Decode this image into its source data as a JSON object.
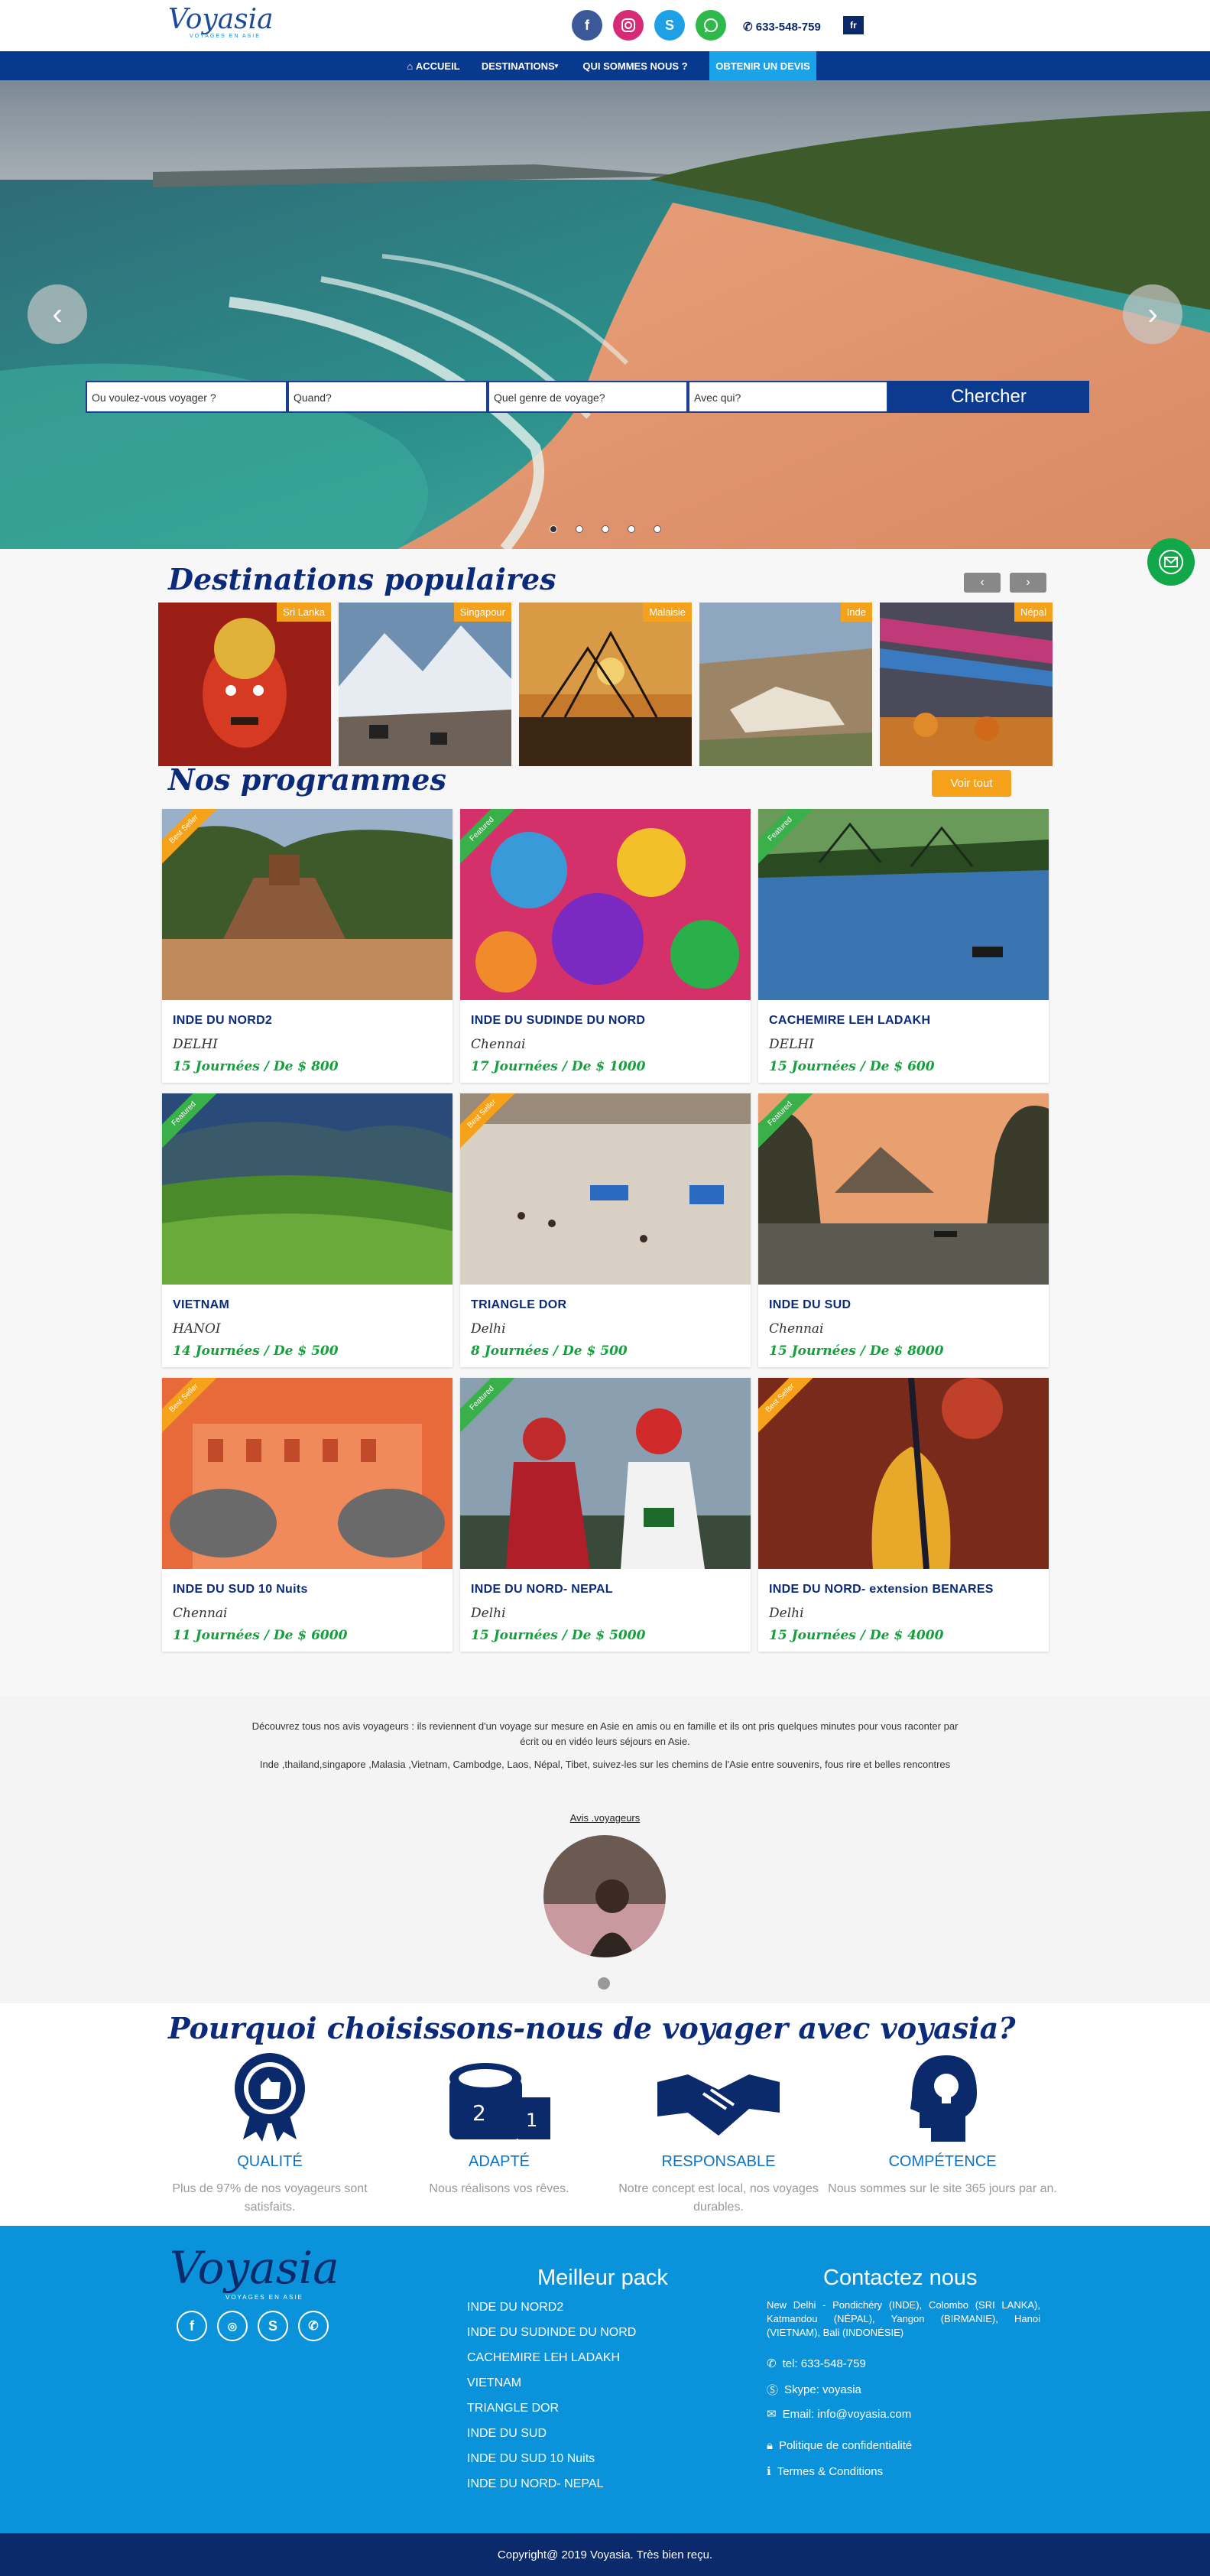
{
  "header": {
    "logo": "Voyasia",
    "logo_sub": "VOYAGES EN ASIE",
    "phone": "633-548-759",
    "lang": "fr",
    "social": [
      "facebook-icon",
      "instagram-icon",
      "skype-icon",
      "whatsapp-icon"
    ]
  },
  "nav": {
    "items": [
      "ACCUEIL",
      "DESTINATIONS",
      "QUI SOMMES NOUS ?",
      "OBTENIR UN DEVIS"
    ]
  },
  "search": {
    "where": "Ou voulez-vous voyager ?",
    "when": "Quand?",
    "kind": "Quel genre de voyage?",
    "with": "Avec qui?",
    "button": "Chercher"
  },
  "destinations": {
    "title": "Destinations populaires",
    "items": [
      "Sri Lanka",
      "Singapour",
      "Malaisie",
      "Inde",
      "Népal"
    ]
  },
  "programs": {
    "title": "Nos programmes",
    "see_all": "Voir tout",
    "cards": [
      {
        "ribbon": "Best Seller",
        "title": "INDE DU NORD2",
        "city": "DELHI",
        "price": "15 Journées / De $ 800"
      },
      {
        "ribbon": "Featured",
        "title": "INDE DU SUDINDE DU NORD",
        "city": "Chennai",
        "price": "17 Journées / De $ 1000"
      },
      {
        "ribbon": "Featured",
        "title": "CACHEMIRE LEH LADAKH",
        "city": "DELHI",
        "price": "15 Journées / De $ 600"
      },
      {
        "ribbon": "Featured",
        "title": "VIETNAM",
        "city": "HANOI",
        "price": "14 Journées / De $ 500"
      },
      {
        "ribbon": "Best Seller",
        "title": "TRIANGLE DOR",
        "city": "Delhi",
        "price": "8 Journées / De $ 500"
      },
      {
        "ribbon": "Featured",
        "title": "INDE DU SUD",
        "city": "Chennai",
        "price": "15 Journées / De $ 8000"
      },
      {
        "ribbon": "Best Seller",
        "title": "INDE DU SUD 10 Nuits",
        "city": "Chennai",
        "price": "11 Journées / De $ 6000"
      },
      {
        "ribbon": "Featured",
        "title": "INDE DU NORD- NEPAL",
        "city": "Delhi",
        "price": "15 Journées / De $ 5000"
      },
      {
        "ribbon": "Best Seller",
        "title": "INDE DU NORD- extension BENARES",
        "city": "Delhi",
        "price": "15 Journées / De $ 4000"
      }
    ]
  },
  "reviews": {
    "p1": "Découvrez tous nos avis voyageurs : ils reviennent d'un voyage sur mesure en Asie en amis ou en famille et ils ont pris quelques minutes pour vous raconter par écrit ou en vidéo leurs séjours en Asie.",
    "p2": "Inde ,thailand,singapore ,Malasia ,Vietnam, Cambodge, Laos, Népal, Tibet, suivez-les sur les chemins de l'Asie entre souvenirs, fous rire et belles rencontres",
    "link": "Avis .voyageurs"
  },
  "why": {
    "title": "Pourquoi choisissons-nous de voyager avec voyasia?",
    "items": [
      {
        "icon": "quality-badge-icon",
        "title": "QUALITÉ",
        "desc": "Plus de 97% de nos voyageurs sont satisfaits."
      },
      {
        "icon": "measuring-tape-icon",
        "title": "ADAPTÉ",
        "desc": "Nous réalisons vos rêves."
      },
      {
        "icon": "handshake-icon",
        "title": "RESPONSABLE",
        "desc": "Notre concept est local, nos voyages durables."
      },
      {
        "icon": "head-lightbulb-icon",
        "title": "COMPÉTENCE",
        "desc": "Nous sommes sur le site 365 jours par an."
      }
    ]
  },
  "footer": {
    "logo": "Voyasia",
    "logo_sub": "VOYAGES EN ASIE",
    "pack_title": "Meilleur pack",
    "pack": [
      "INDE DU NORD2",
      "INDE DU SUDINDE DU NORD",
      "CACHEMIRE LEH LADAKH",
      "VIETNAM",
      "TRIANGLE DOR",
      "INDE DU SUD",
      "INDE DU SUD 10 Nuits",
      "INDE DU NORD- NEPAL"
    ],
    "contact_title": "Contactez nous",
    "address": "New Delhi - Pondichéry (INDE), Colombo (SRI LANKA), Katmandou (NÉPAL), Yangon (BIRMANIE), Hanoi (VIETNAM), Bali (INDONÉSIE)",
    "tel": "tel: 633-548-759",
    "skype": "Skype: voyasia",
    "email": "Email: info@voyasia.com",
    "privacy": "Politique de confidentialité",
    "terms": "Termes & Conditions",
    "copyright": "Copyright@ 2019 Voyasia. Très bien reçu."
  }
}
